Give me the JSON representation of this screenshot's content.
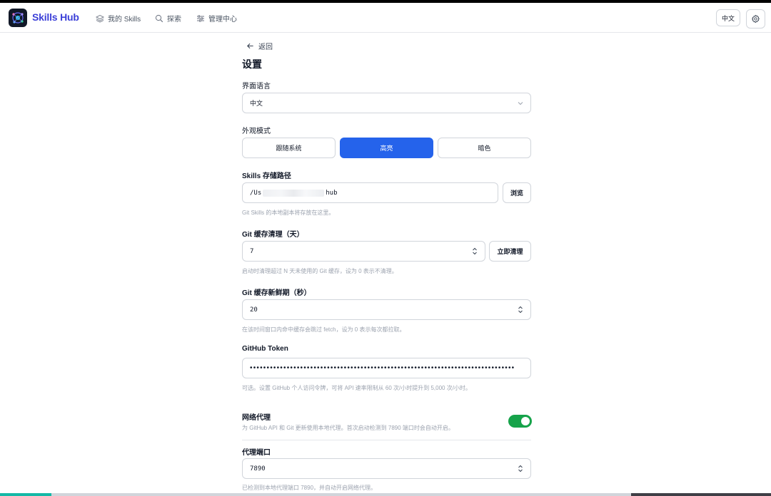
{
  "nav": {
    "brand": "Skills Hub",
    "items": [
      {
        "label": "我的 Skills",
        "icon": "layers-icon"
      },
      {
        "label": "探索",
        "icon": "search-icon"
      },
      {
        "label": "管理中心",
        "icon": "sliders-icon"
      }
    ],
    "lang_button": "中文",
    "settings_icon": "gear-icon"
  },
  "page": {
    "back_label": "返回",
    "title": "设置"
  },
  "language": {
    "label": "界面语言",
    "selected": "中文"
  },
  "appearance": {
    "label": "外观模式",
    "options": [
      "跟随系统",
      "高亮",
      "暗色"
    ],
    "active": "高亮",
    "accent_color": "#2563eb"
  },
  "storage": {
    "label": "Skills 存储路径",
    "path_start": "/Us",
    "path_end": "hub",
    "browse": "浏览",
    "hint": "Git Skills 的本地副本将存放在这里。"
  },
  "git_cache_cleanup": {
    "label": "Git 缓存清理（天）",
    "value": "7",
    "action": "立即清理",
    "hint": "启动时清理超过 N 天未使用的 Git 缓存，设为 0 表示不清理。"
  },
  "git_cache_fresh": {
    "label": "Git 缓存新鲜期（秒）",
    "value": "20",
    "hint": "在该时间窗口内命中缓存会跳过 fetch，设为 0 表示每次都拉取。"
  },
  "github_token": {
    "label": "GitHub Token",
    "value": "•••••••••••••••••••••••••••••••••••••••••••••••••••••••••••••••••••••••••••••••",
    "hint": "可选。设置 GitHub 个人访问令牌，可将 API 速率限制从 60 次/小时提升到 5,000 次/小时。"
  },
  "proxy": {
    "label": "网络代理",
    "description": "为 GitHub API 和 Git 更新使用本地代理。首次启动检测到 7890 端口时会自动开启。",
    "enabled": true,
    "toggle_color": "#16a34a"
  },
  "proxy_port": {
    "label": "代理端口",
    "value": "7890",
    "hint": "已检测到本地代理端口 7890，并自动开启网络代理。"
  }
}
